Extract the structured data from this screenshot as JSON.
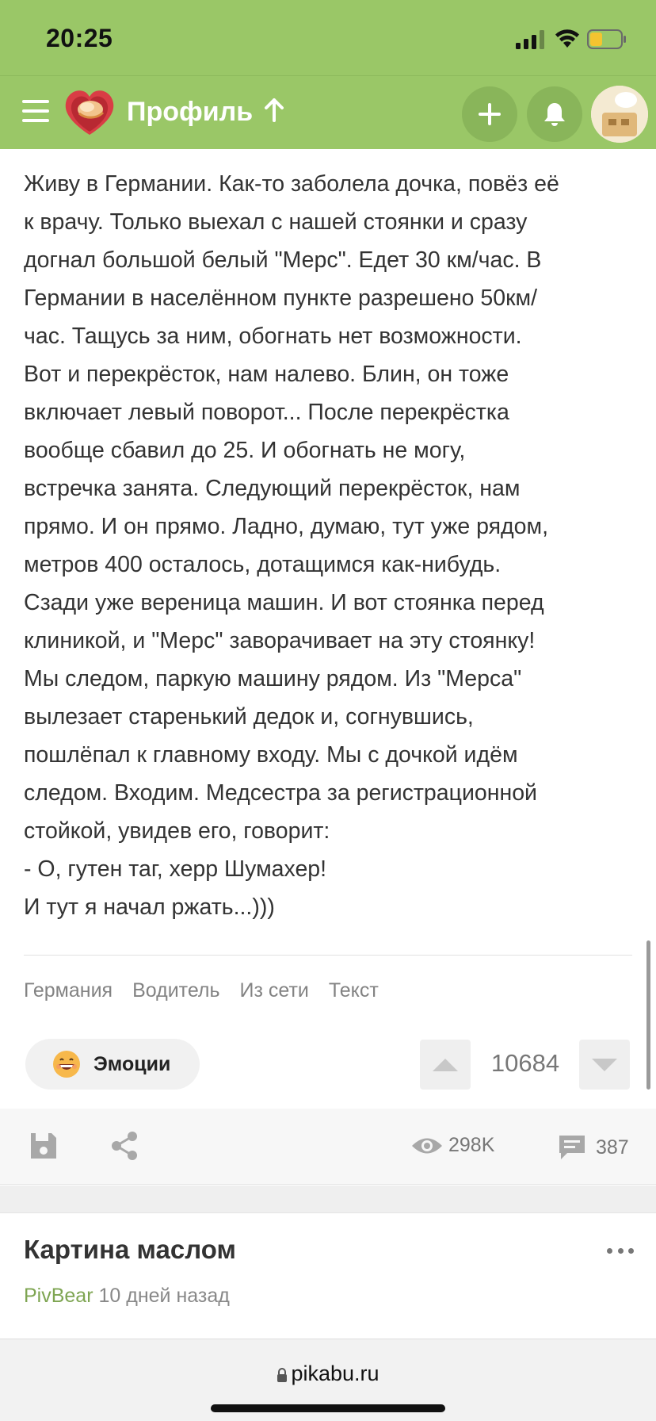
{
  "status_bar": {
    "time": "20:25",
    "battery_color": "#f4c430"
  },
  "nav": {
    "title": "Профиль"
  },
  "article": {
    "lines": [
      "Живу в Германии. Как-то заболела дочка, повёз её",
      "к врачу. Только выехал с нашей стоянки и сразу",
      "догнал большой белый \"Мерс\". Едет 30 км/час. В",
      "Германии в населённом пункте разрешено 50км/",
      "час. Тащусь за ним, обогнать нет возможности.",
      "Вот и перекрёсток, нам налево. Блин, он тоже",
      "включает левый поворот... После перекрёстка",
      "вообще сбавил до 25. И обогнать не могу,",
      "встречка занята. Следующий перекрёсток, нам",
      "прямо. И он прямо. Ладно, думаю, тут уже рядом,",
      "метров 400 осталось, дотащимся как-нибудь.",
      "Сзади уже вереница машин. И вот стоянка перед",
      "клиникой, и \"Мерс\" заворачивает на эту стоянку!",
      "Мы следом, паркую машину рядом. Из \"Мерса\"",
      "вылезает старенький дедок и, согнувшись,",
      "пошлёпал к главному входу. Мы с дочкой идём",
      "следом. Входим. Медсестра за регистрационной",
      "стойкой, увидев его, говорит:",
      "- О, гутен таг, херр Шумахер!",
      "И тут я начал ржать...)))"
    ]
  },
  "tags": [
    "Германия",
    "Водитель",
    "Из сети",
    "Текст"
  ],
  "emotion_button": {
    "label": "Эмоции",
    "icon": "grinning-face-icon"
  },
  "rating": {
    "value": "10684"
  },
  "actions": {
    "views": "298K",
    "comments": "387"
  },
  "next_post": {
    "title": "Картина маслом",
    "author": "PivBear",
    "time": "10 дней назад"
  },
  "browser": {
    "url": "pikabu.ru"
  },
  "colors": {
    "accent": "#9ac767",
    "author": "#7ea552"
  }
}
